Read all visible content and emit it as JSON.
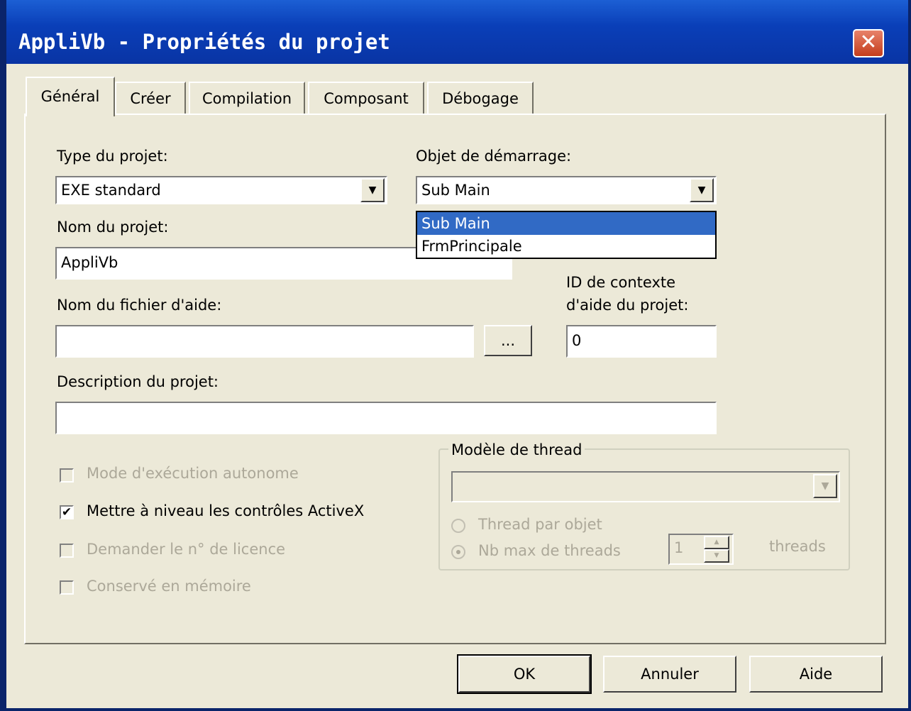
{
  "window": {
    "title": "AppliVb - Propriétés du projet",
    "close_icon": "✕"
  },
  "tabs": [
    {
      "label": "Général",
      "active": true
    },
    {
      "label": "Créer"
    },
    {
      "label": "Compilation"
    },
    {
      "label": "Composant"
    },
    {
      "label": "Débogage"
    }
  ],
  "general": {
    "project_type": {
      "label": "Type du projet:",
      "value": "EXE standard"
    },
    "startup_object": {
      "label": "Objet de démarrage:",
      "value": "Sub Main",
      "options": [
        "Sub Main",
        "FrmPrincipale"
      ],
      "highlighted": "Sub Main"
    },
    "project_name": {
      "label": "Nom du projet:",
      "value": "AppliVb"
    },
    "help_file": {
      "label": "Nom du fichier d'aide:",
      "value": "",
      "browse": "..."
    },
    "help_context": {
      "label_line1": "ID de contexte",
      "label_line2": "d'aide du projet:",
      "value": "0"
    },
    "description": {
      "label": "Description du projet:",
      "value": ""
    },
    "checkboxes": {
      "unattended": {
        "label": "Mode d'exécution autonome",
        "checked": false,
        "enabled": false
      },
      "upgrade_activex": {
        "label": "Mettre à niveau les contrôles ActiveX",
        "checked": true,
        "enabled": true,
        "mark": "✔"
      },
      "license_key": {
        "label": "Demander le n° de licence",
        "checked": false,
        "enabled": false
      },
      "retained": {
        "label": "Conservé en mémoire",
        "checked": false,
        "enabled": false
      }
    },
    "threading": {
      "legend": "Modèle de thread",
      "model_value": "",
      "per_object": {
        "label": "Thread par objet",
        "selected": false
      },
      "pool": {
        "label": "Nb max de threads",
        "selected": true,
        "count": "1"
      },
      "unit": "threads"
    }
  },
  "buttons": {
    "ok": "OK",
    "cancel": "Annuler",
    "help": "Aide"
  },
  "icons": {
    "dropdown_arrow": "▼",
    "spin_up": "▲",
    "spin_down": "▼"
  }
}
